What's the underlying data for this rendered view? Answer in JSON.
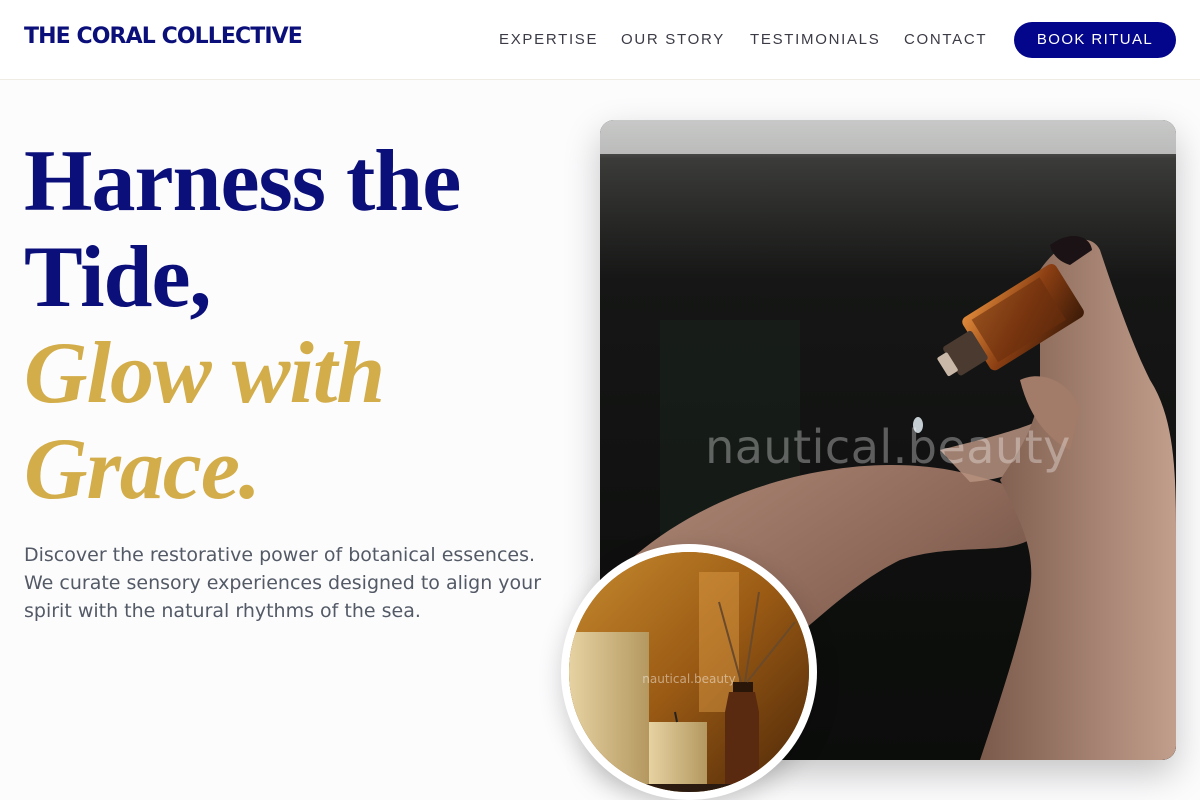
{
  "header": {
    "logo": "THE CORAL COLLECTIVE",
    "nav": [
      {
        "label": "EXPERTISE"
      },
      {
        "label": "OUR STORY"
      },
      {
        "label": "TESTIMONIALS"
      },
      {
        "label": "CONTACT"
      }
    ],
    "cta_label": "BOOK RITUAL"
  },
  "hero": {
    "headline_lines": [
      "Harness the",
      "Tide,"
    ],
    "headline_accent_lines": [
      "Glow with",
      "Grace."
    ],
    "lede": "Discover the restorative power of botanical essences. We curate sensory experiences designed to align your spirit with the natural rhythms of the sea.",
    "photo_watermark": "nautical.beauty",
    "inset_watermark": "nautical.beauty"
  },
  "colors": {
    "brand_navy": "#0b0f7a",
    "cta_blue": "#03058a",
    "accent_gold": "#d3ad4a",
    "body_text": "#535a66"
  }
}
